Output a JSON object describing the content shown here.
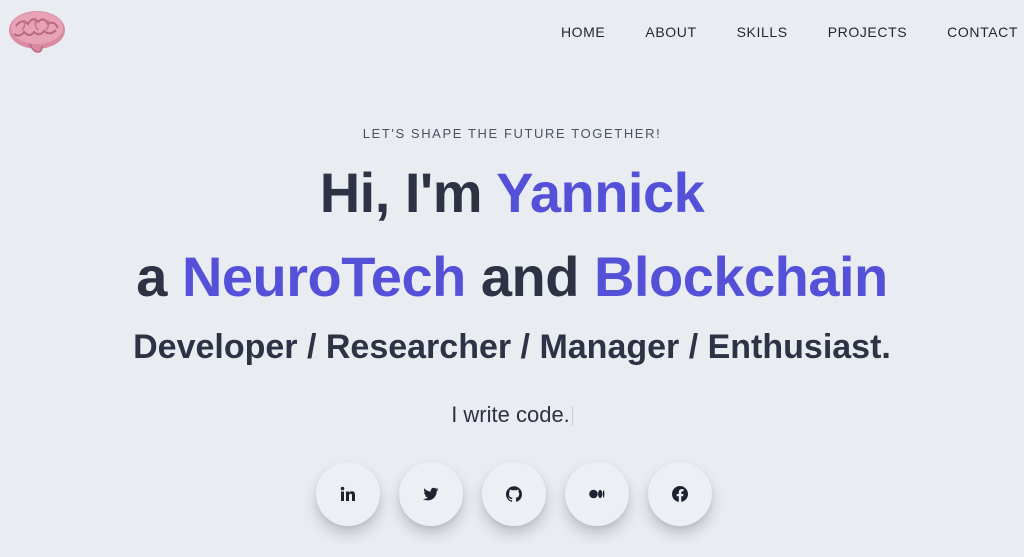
{
  "logo": {
    "icon": "brain-icon"
  },
  "nav": {
    "items": [
      {
        "label": "HOME"
      },
      {
        "label": "ABOUT"
      },
      {
        "label": "SKILLS"
      },
      {
        "label": "PROJECTS"
      },
      {
        "label": "CONTACT"
      }
    ]
  },
  "hero": {
    "tagline": "LET'S SHAPE THE FUTURE TOGETHER!",
    "line1_prefix": "Hi, I'm ",
    "name": "Yannick",
    "line2_prefix": "a ",
    "field1": "NeuroTech",
    "line2_mid": " and ",
    "field2": "Blockchain",
    "roles": "Developer / Researcher / Manager / Enthusiast.",
    "typed_text": "I write code."
  },
  "colors": {
    "accent": "#5451d8",
    "text": "#2d3344",
    "background": "#e9edf2"
  },
  "socials": [
    {
      "icon": "linkedin-icon"
    },
    {
      "icon": "twitter-icon"
    },
    {
      "icon": "github-icon"
    },
    {
      "icon": "medium-icon"
    },
    {
      "icon": "facebook-icon"
    }
  ]
}
